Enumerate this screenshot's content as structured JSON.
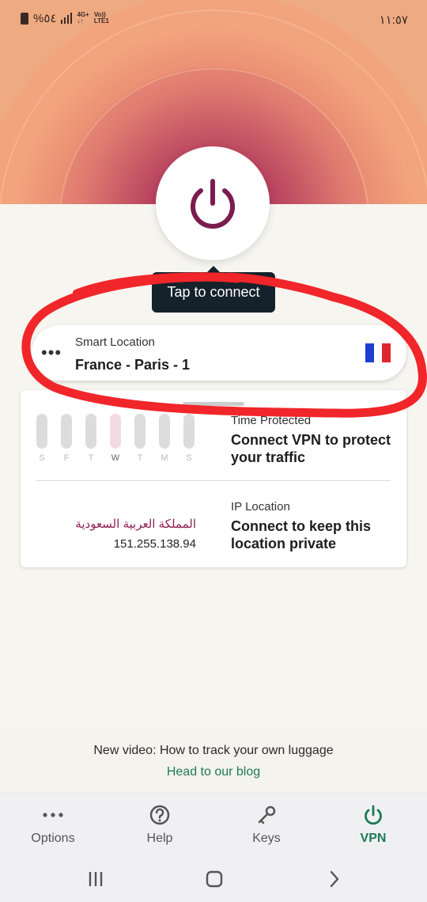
{
  "status_bar": {
    "battery": "%٥٤",
    "network_top": "4G+",
    "network_arrows": "↓↑",
    "volte": "Vo)) LTE1",
    "time": "١١:٥٧"
  },
  "connect": {
    "tooltip": "Tap to connect",
    "power_color": "#7a1d4e"
  },
  "location": {
    "label": "Smart Location",
    "name": "France - Paris - 1",
    "flag_colors": [
      "#1f3ecf",
      "#ffffff",
      "#e0252f"
    ]
  },
  "stats": {
    "days": [
      "S",
      "F",
      "T",
      "W",
      "T",
      "M",
      "S"
    ],
    "today_index": 3,
    "time_label": "Time Protected",
    "time_message": "Connect VPN to protect your traffic",
    "ip_label": "IP Location",
    "ip_message": "Connect to keep this location private",
    "country": "المملكة العربية السعودية",
    "ip_address": "151.255.138.94"
  },
  "promo": {
    "text": "New video: How to track your own luggage",
    "link": "Head to our blog"
  },
  "nav": {
    "items": [
      {
        "label": "Options",
        "icon": "more-icon"
      },
      {
        "label": "Help",
        "icon": "help-icon"
      },
      {
        "label": "Keys",
        "icon": "key-icon"
      },
      {
        "label": "VPN",
        "icon": "power-icon",
        "active": true
      }
    ]
  },
  "colors": {
    "accent_green": "#1d7a55",
    "brand_maroon": "#8d1f52",
    "annotation_red": "#f0262a"
  }
}
